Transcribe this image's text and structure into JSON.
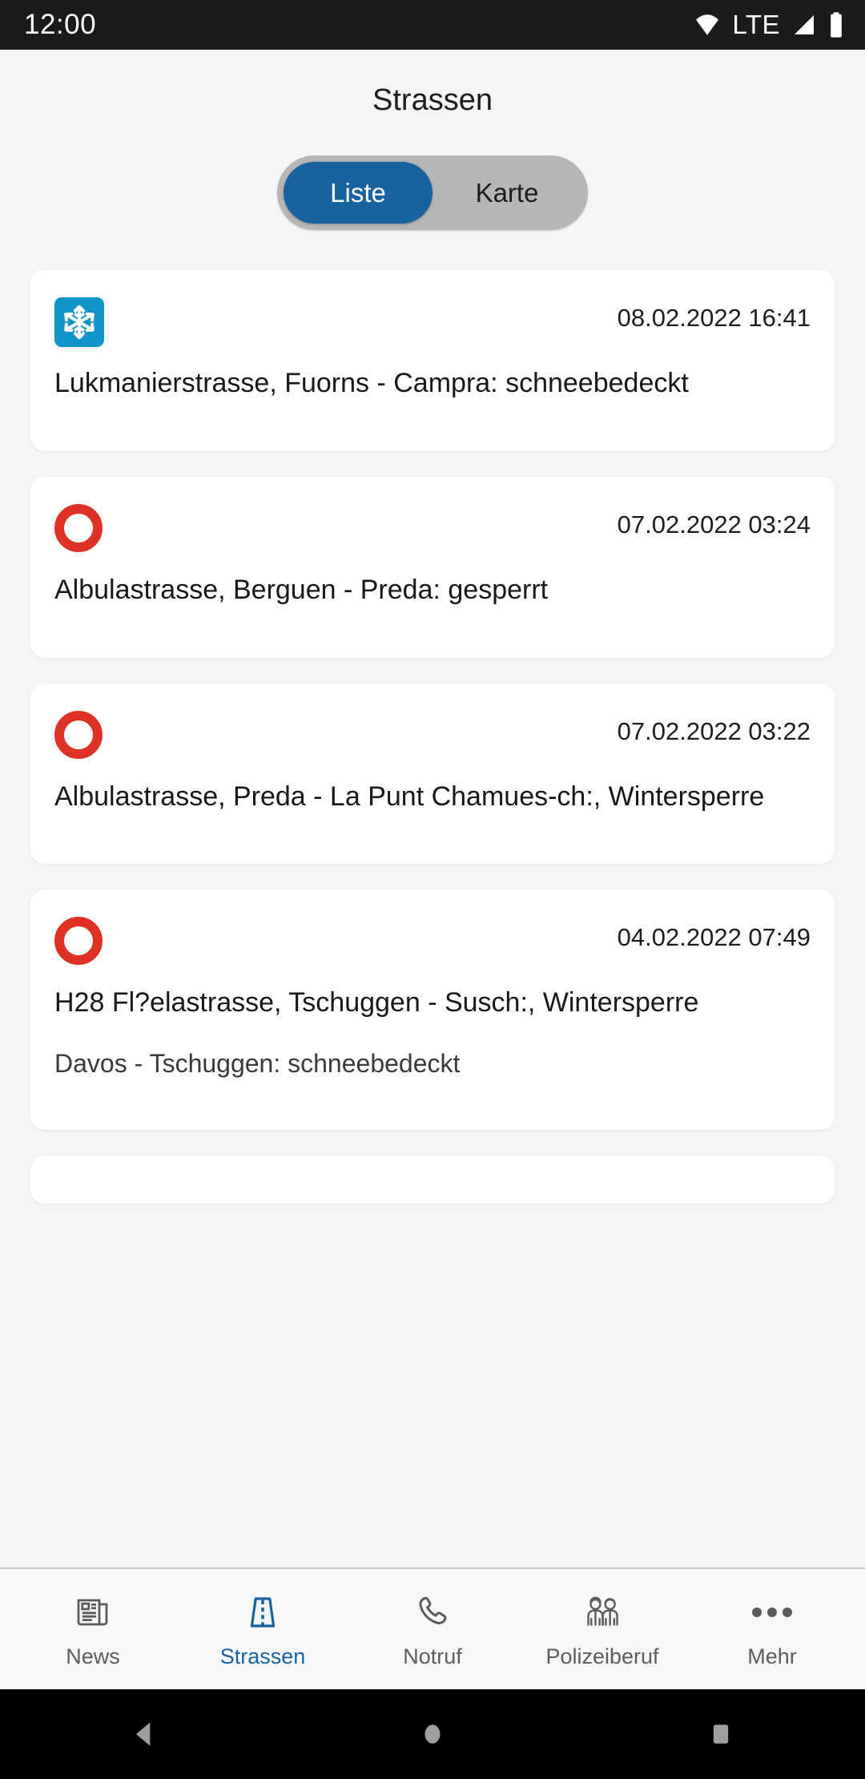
{
  "status_bar": {
    "time": "12:00",
    "network_label": "LTE",
    "icons": [
      "wifi-icon",
      "signal-icon",
      "battery-icon"
    ]
  },
  "header": {
    "title": "Strassen"
  },
  "segmented_control": {
    "options": [
      {
        "label": "Liste",
        "active": true
      },
      {
        "label": "Karte",
        "active": false
      }
    ]
  },
  "colors": {
    "accent_blue": "#17629f",
    "snow_icon_blue": "#1195c9",
    "closed_red": "#dd3225",
    "page_bg": "#f4f5f7",
    "card_bg": "#ffffff",
    "status_bar_bg": "#1b1b1b"
  },
  "list": {
    "items": [
      {
        "icon": "snowflake-icon",
        "date": "08.02.2022 16:41",
        "title": "Lukmanierstrasse,  Fuorns - Campra: schneebedeckt",
        "subtitle": ""
      },
      {
        "icon": "closed-ring-icon",
        "date": "07.02.2022 03:24",
        "title": "Albulastrasse,  Berguen - Preda: gesperrt",
        "subtitle": ""
      },
      {
        "icon": "closed-ring-icon",
        "date": "07.02.2022 03:22",
        "title": "Albulastrasse,  Preda - La Punt Chamues-ch:, Wintersperre",
        "subtitle": ""
      },
      {
        "icon": "closed-ring-icon",
        "date": "04.02.2022 07:49",
        "title": "H28 Fl?elastrasse,  Tschuggen - Susch:, Wintersperre",
        "subtitle": "Davos - Tschuggen: schneebedeckt"
      }
    ]
  },
  "bottom_nav": {
    "items": [
      {
        "label": "News",
        "icon": "newspaper-icon",
        "active": false
      },
      {
        "label": "Strassen",
        "icon": "road-icon",
        "active": true
      },
      {
        "label": "Notruf",
        "icon": "phone-icon",
        "active": false
      },
      {
        "label": "Polizeiberuf",
        "icon": "people-icon",
        "active": false
      },
      {
        "label": "Mehr",
        "icon": "more-dots-icon",
        "active": false
      }
    ]
  },
  "system_nav": {
    "buttons": [
      "back-icon",
      "home-icon",
      "recents-icon"
    ]
  }
}
